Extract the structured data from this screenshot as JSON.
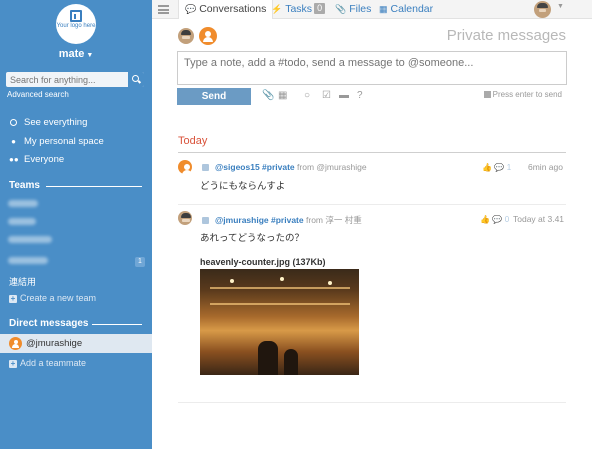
{
  "sidebar": {
    "logo_text": "Your logo here",
    "user": "mate",
    "search_placeholder": "Search for anything...",
    "advanced_search": "Advanced search",
    "nav": [
      {
        "label": "See everything",
        "icon": "ring-icon"
      },
      {
        "label": "My personal space",
        "icon": "person-icon"
      },
      {
        "label": "Everyone",
        "icon": "group-icon"
      }
    ],
    "teams_title": "Teams",
    "team_badge": "1",
    "team_visible": "連結用",
    "create_team": "Create a new team",
    "dm_title": "Direct messages",
    "dm_active": "@jmurashige",
    "add_teammate": "Add a teammate"
  },
  "topbar": {
    "tabs": {
      "conversations": "Conversations",
      "tasks": "Tasks",
      "tasks_count": "0",
      "files": "Files",
      "calendar": "Calendar"
    }
  },
  "composer": {
    "title": "Private messages",
    "placeholder": "Type a note, add a #todo, send a message to @someone...",
    "send_label": "Send",
    "press_enter": "Press enter to send"
  },
  "feed": {
    "day_label": "Today",
    "messages": [
      {
        "user": "@sigeos15",
        "tag": "#private",
        "from_label": "from @jmurashige",
        "likes": "1",
        "time": "6min ago",
        "text": "どうにもならんすよ"
      },
      {
        "user": "@jmurashige",
        "tag": "#private",
        "from_label": "from 淳一 村重",
        "likes": "0",
        "time": "Today at 3.41",
        "text": "あれってどうなったの？",
        "attachment": "heavenly-counter.jpg (137Kb)"
      }
    ]
  },
  "colors": {
    "sidebar_bg": "#4a8ec7",
    "accent": "#3a7fbf",
    "today": "#d9533b",
    "send_button": "#6b9bc4"
  }
}
